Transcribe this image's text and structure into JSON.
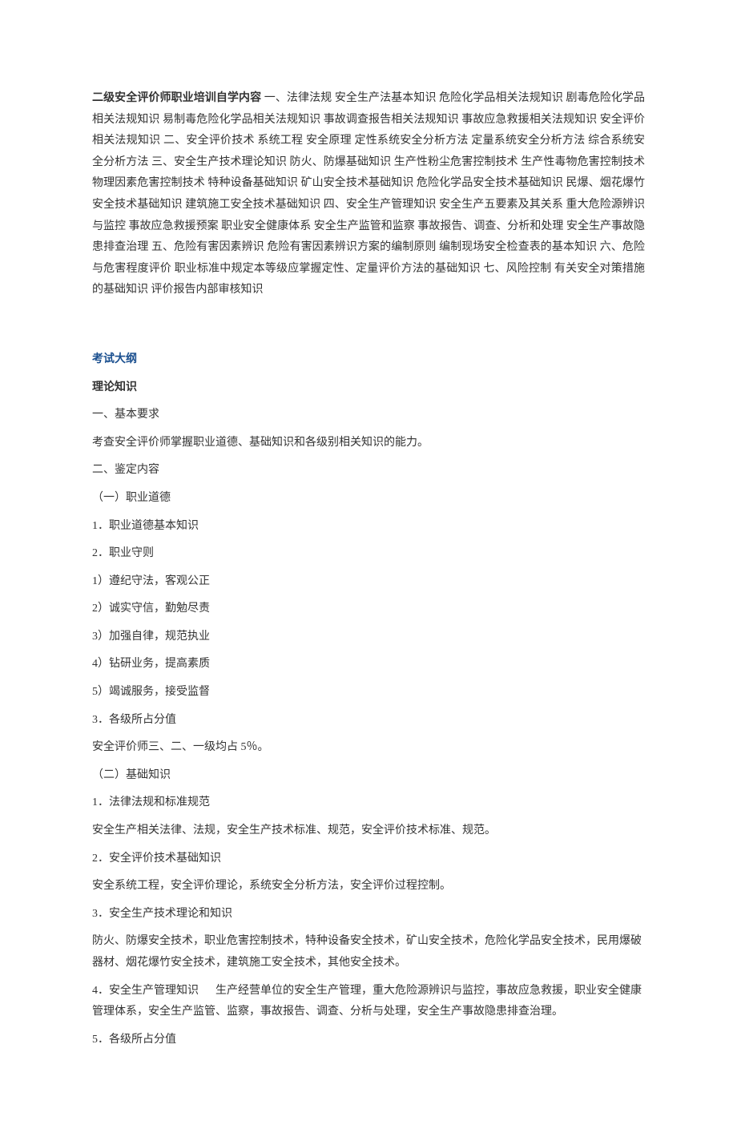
{
  "intro": {
    "lead": "二级安全评价师职业培训自学内容",
    "body": " 一、法律法规 安全生产法基本知识 危险化学品相关法规知识 剧毒危险化学品相关法规知识 易制毒危险化学品相关法规知识 事故调查报告相关法规知识 事故应急救援相关法规知识 安全评价相关法规知识 二、安全评价技术 系统工程 安全原理 定性系统安全分析方法 定量系统安全分析方法 综合系统安全分析方法 三、安全生产技术理论知识 防火、防爆基础知识 生产性粉尘危害控制技术 生产性毒物危害控制技术 物理因素危害控制技术 特种设备基础知识 矿山安全技术基础知识 危险化学品安全技术基础知识 民爆、烟花爆竹安全技术基础知识 建筑施工安全技术基础知识 四、安全生产管理知识 安全生产五要素及其关系 重大危险源辨识与监控 事故应急救援预案 职业安全健康体系 安全生产监管和监察 事故报告、调查、分析和处理 安全生产事故隐患排查治理 五、危险有害因素辨识 危险有害因素辨识方案的编制原则 编制现场安全检查表的基本知识 六、危险与危害程度评价 职业标准中规定本等级应掌握定性、定量评价方法的基础知识 七、风险控制 有关安全对策措施的基础知识 评价报告内部审核知识"
  },
  "section_heading": "考试大纲",
  "sub_heading": "理论知识",
  "lines": [
    "一、基本要求",
    "考查安全评价师掌握职业道德、基础知识和各级别相关知识的能力。",
    "二、鉴定内容",
    "（一）职业道德",
    "1．职业道德基本知识",
    "2．职业守则",
    "1）遵纪守法，客观公正",
    "2）诚实守信，勤勉尽责",
    "3）加强自律，规范执业",
    "4）钻研业务，提高素质",
    "5）竭诚服务，接受监督",
    "3．各级所占分值",
    "安全评价师三、二、一级均占 5％。",
    "（二）基础知识",
    "1．法律法规和标准规范",
    "安全生产相关法律、法规，安全生产技术标准、规范，安全评价技术标准、规范。",
    "2．安全评价技术基础知识",
    "安全系统工程，安全评价理论，系统安全分析方法，安全评价过程控制。",
    "3．安全生产技术理论和知识",
    "防火、防爆安全技术，职业危害控制技术，特种设备安全技术，矿山安全技术，危险化学品安全技术，民用爆破器材、烟花爆竹安全技术，建筑施工安全技术，其他安全技术。",
    "4．安全生产管理知识 　 生产经营单位的安全生产管理，重大危险源辨识与监控，事故应急救援，职业安全健康管理体系，安全生产监管、监察，事故报告、调查、分析与处理，安全生产事故隐患排查治理。",
    "5．各级所占分值"
  ]
}
